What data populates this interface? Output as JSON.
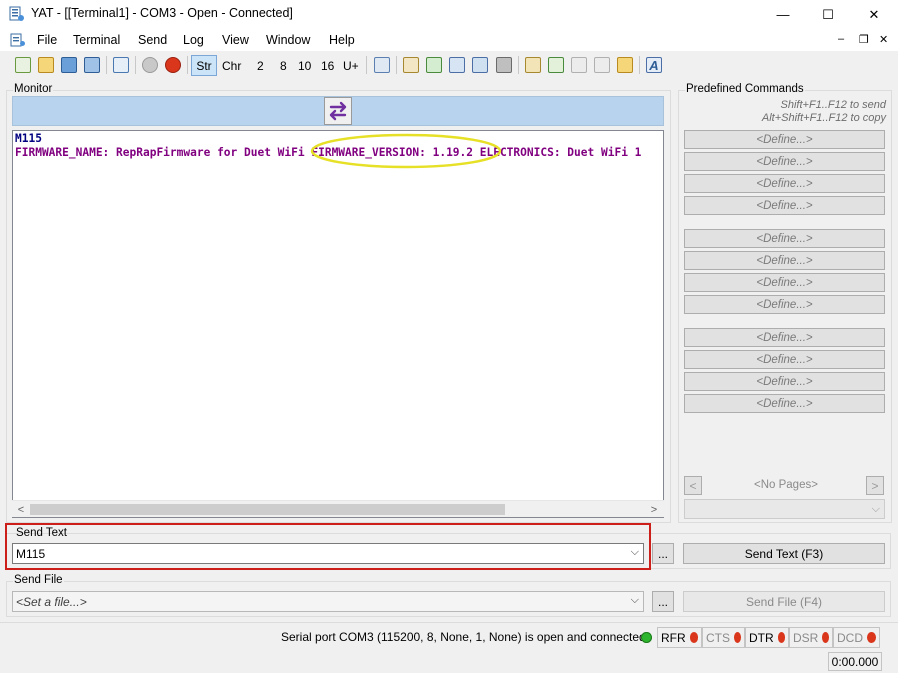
{
  "window": {
    "title": "YAT - [[Terminal1] - COM3 - Open - Connected]",
    "minimize": "—",
    "maximize": "☐",
    "close": "✕"
  },
  "menu": {
    "items": [
      "File",
      "Terminal",
      "Send",
      "Log",
      "View",
      "Window",
      "Help"
    ],
    "mdi_min": "‒",
    "mdi_restore": "❐",
    "mdi_close": "✕"
  },
  "toolbar": {
    "str": "Str",
    "chr": "Chr",
    "radix": [
      "2",
      "8",
      "10",
      "16",
      "U+"
    ]
  },
  "monitor": {
    "label": "Monitor",
    "lines": [
      "M115",
      "FIRMWARE_NAME: RepRapFirmware for Duet WiFi FIRMWARE_VERSION: 1.19.2 ELECTRONICS: Duet WiFi 1"
    ],
    "scroll_left": "<",
    "scroll_right": ">"
  },
  "predefined": {
    "label": "Predefined Commands",
    "hint_send": "Shift+F1..F12 to send",
    "hint_copy": "Alt+Shift+F1..F12 to copy",
    "define_label": "<Define...>",
    "no_pages": "<No Pages>",
    "prev": "<",
    "next": ">"
  },
  "send_text": {
    "label": "Send Text",
    "value": "M115",
    "dots": "...",
    "button": "Send Text (F3)"
  },
  "send_file": {
    "label": "Send File",
    "placeholder": "<Set a file...>",
    "dots": "...",
    "button": "Send File (F4)"
  },
  "status": {
    "message": "Serial port COM3 (115200, 8, None, 1, None) is open and connected",
    "signals": [
      {
        "name": "RFR",
        "state": "red",
        "enabled": true
      },
      {
        "name": "CTS",
        "state": "red",
        "enabled": false
      },
      {
        "name": "DTR",
        "state": "red",
        "enabled": true
      },
      {
        "name": "DSR",
        "state": "red",
        "enabled": false
      },
      {
        "name": "DCD",
        "state": "red",
        "enabled": false
      }
    ],
    "timer": "0:00.000"
  },
  "colors": {
    "annotation_ellipse": "#e6e026",
    "annotation_box": "#cc1f1a",
    "led_green": "#2db52d",
    "led_red": "#d9361b",
    "monitor_cmd": "#000080",
    "monitor_resp": "#800080"
  }
}
